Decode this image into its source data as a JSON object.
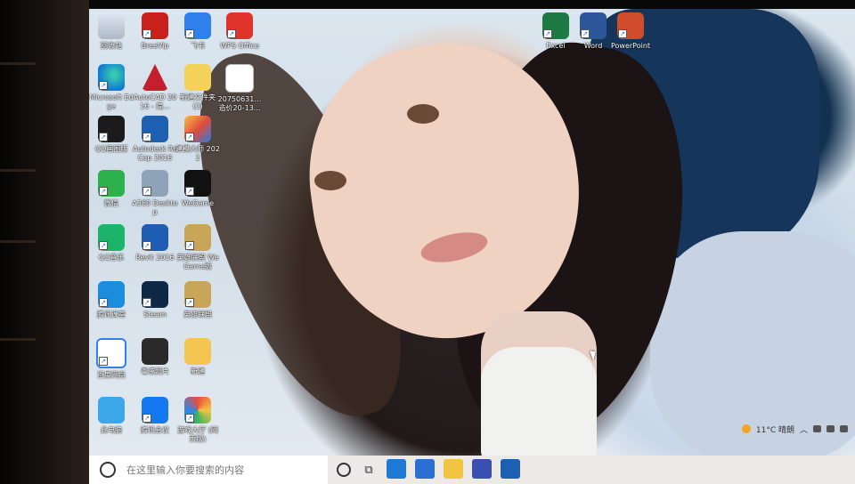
{
  "desktop": {
    "icons": [
      {
        "label": "回收站",
        "icon": "recycle-bin-icon"
      },
      {
        "label": "BreeVip",
        "icon": "breevip-icon"
      },
      {
        "label": "飞书",
        "icon": "feishu-icon"
      },
      {
        "label": "WPS Office",
        "icon": "wps-office-icon"
      },
      {
        "label": "Excel",
        "icon": "excel-icon"
      },
      {
        "label": "Word",
        "icon": "word-icon"
      },
      {
        "label": "PowerPoint",
        "icon": "powerpoint-icon"
      },
      {
        "label": "Microsoft Edge",
        "icon": "edge-icon"
      },
      {
        "label": "AutoCAD 2016 - 简...",
        "icon": "autocad-icon"
      },
      {
        "label": "新建文件夹 (2)",
        "icon": "zip-folder-icon"
      },
      {
        "label": "20750631…造价20-13...",
        "icon": "word-document-icon"
      },
      {
        "label": "QQ画图版",
        "icon": "qq-icon"
      },
      {
        "label": "Autodesk ReCap 2016",
        "icon": "recap-icon"
      },
      {
        "label": "建模大师 2022",
        "icon": "modeling-master-icon"
      },
      {
        "label": "微信",
        "icon": "wechat-icon"
      },
      {
        "label": "A360 Desktop",
        "icon": "a360-icon"
      },
      {
        "label": "WeGame",
        "icon": "wegame-icon"
      },
      {
        "label": "QQ音乐",
        "icon": "qq-music-icon"
      },
      {
        "label": "Revit 2016",
        "icon": "revit-icon"
      },
      {
        "label": "英雄联盟 WeGame版",
        "icon": "lol-wegame-icon"
      },
      {
        "label": "腾讯课堂",
        "icon": "tencent-classroom-icon"
      },
      {
        "label": "Steam",
        "icon": "steam-icon"
      },
      {
        "label": "英雄联盟",
        "icon": "lol-icon"
      },
      {
        "label": "百度网盘",
        "icon": "baidu-netdisk-icon"
      },
      {
        "label": "毒液照片",
        "icon": "photo-icon"
      },
      {
        "label": "新建",
        "icon": "folder-icon"
      },
      {
        "label": "此电脑",
        "icon": "this-pc-icon"
      },
      {
        "label": "腾讯会议",
        "icon": "tencent-meeting-icon"
      },
      {
        "label": "游戏大厅 (网页版)",
        "icon": "game-hall-icon"
      }
    ]
  },
  "taskbar": {
    "search_placeholder": "在这里输入你要搜索的内容",
    "apps": [
      "mail-icon",
      "store-icon",
      "file-explorer-icon",
      "autocad-taskbar-icon",
      "revit-taskbar-icon"
    ]
  },
  "tray": {
    "weather": "11°C 晴朗"
  }
}
